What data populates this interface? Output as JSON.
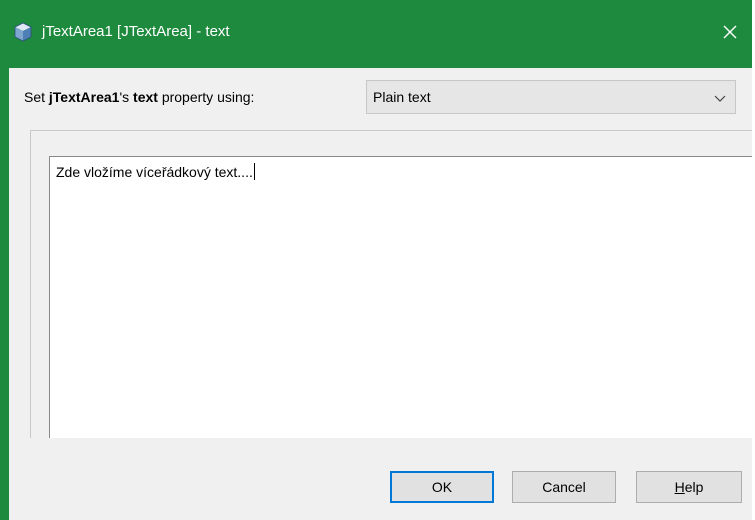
{
  "window": {
    "title": "jTextArea1 [JTextArea] - text",
    "title_icon": "cube-icon",
    "close_icon": "close-icon",
    "accent_color": "#1e8a3e"
  },
  "property_row": {
    "prefix": "Set ",
    "component_name": "jTextArea1",
    "possessive": "'s ",
    "property_name": "text",
    "suffix": " property using:",
    "editor_select": {
      "selected": "Plain text"
    }
  },
  "editor": {
    "text": "Zde vložíme víceřádkový text...."
  },
  "buttons": {
    "ok": "OK",
    "cancel": "Cancel",
    "help_mnemonic": "H",
    "help_rest": "elp"
  }
}
